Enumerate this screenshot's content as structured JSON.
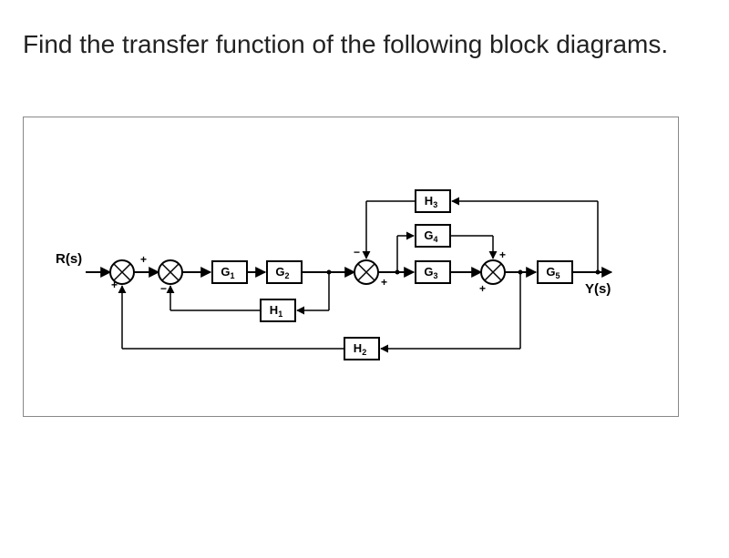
{
  "title": "Find the transfer function of the following block diagrams.",
  "diagram": {
    "input": "R(s)",
    "output": "Y(s)",
    "blocks": {
      "G1": "G",
      "G1_sub": "1",
      "G2": "G",
      "G2_sub": "2",
      "G3": "G",
      "G3_sub": "3",
      "G4": "G",
      "G4_sub": "4",
      "G5": "G",
      "G5_sub": "5",
      "H1": "H",
      "H1_sub": "1",
      "H2": "H",
      "H2_sub": "2",
      "H3": "H",
      "H3_sub": "3"
    },
    "signs": {
      "sum1_top": "+",
      "sum1_bottom": "+",
      "sum2_top": "+",
      "sum2_bottom": "−",
      "sum3_top": "−",
      "sum3_after": "+",
      "sum4_top": "+",
      "sum4_bottom": "+"
    }
  }
}
